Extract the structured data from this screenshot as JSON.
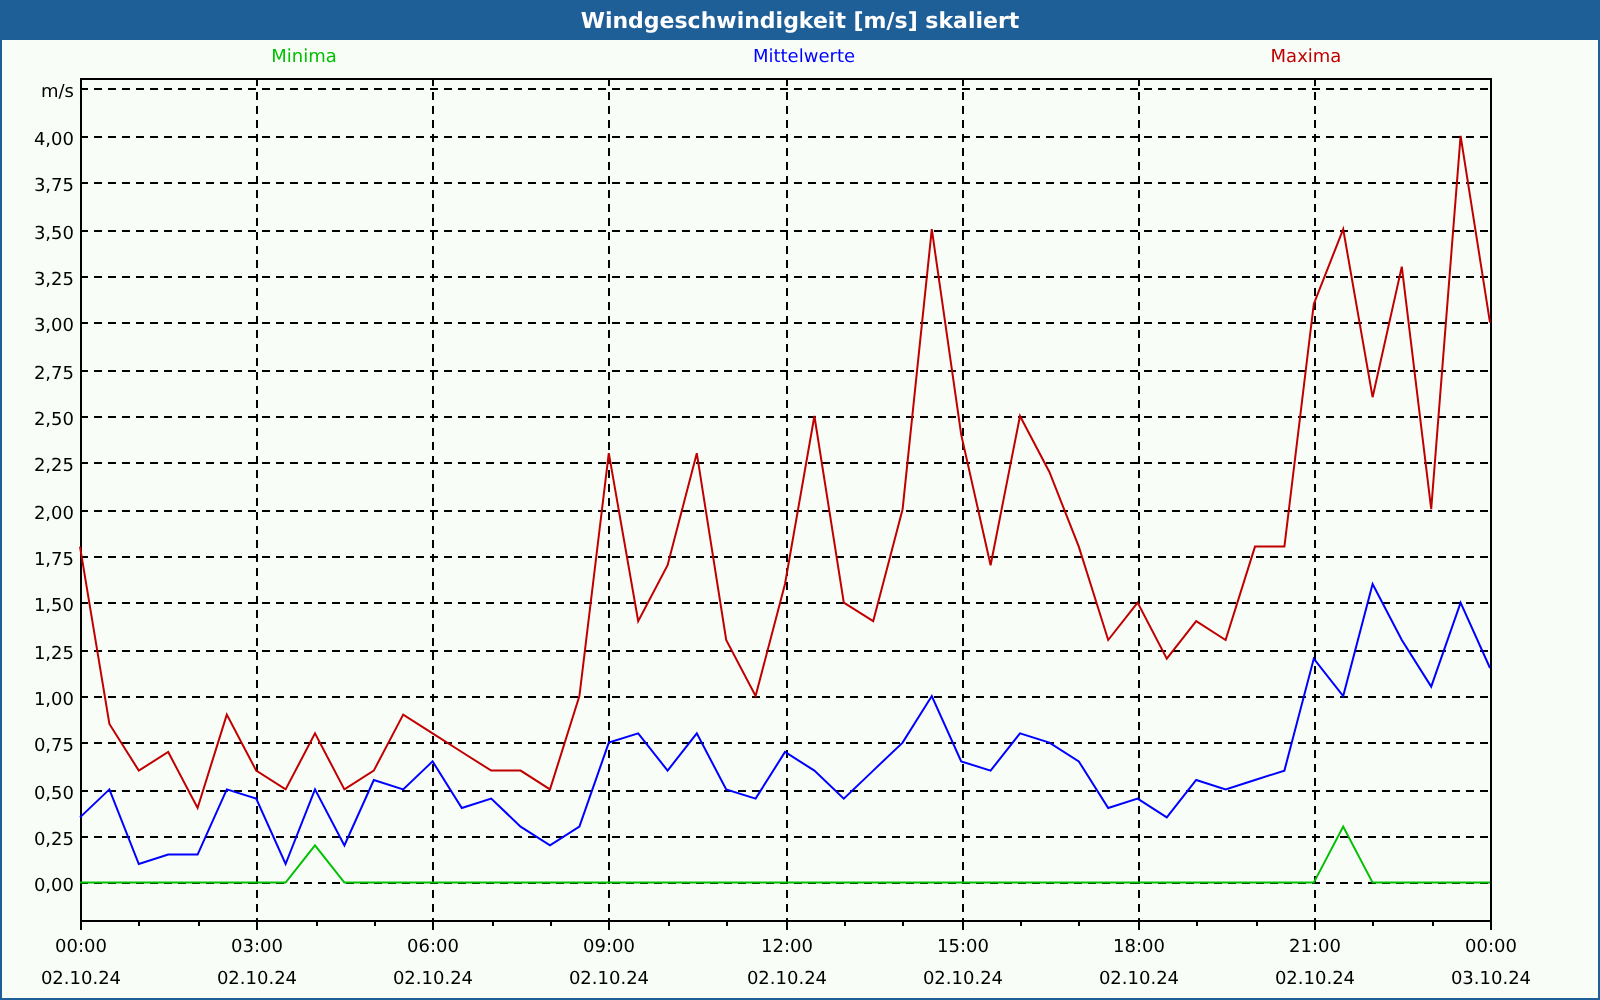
{
  "window": {
    "title": "Windgeschwindigkeit [m/s] skaliert"
  },
  "chart": {
    "chart_data": {
      "type": "line",
      "grid": true,
      "ylabel": "m/s",
      "ylim": [
        -0.2,
        4.31
      ],
      "categories": [
        "00:00\n02.10.24",
        null,
        null,
        null,
        null,
        null,
        "03:00\n02.10.24",
        null,
        null,
        null,
        null,
        null,
        "06:00\n02.10.24",
        null,
        null,
        null,
        null,
        null,
        "09:00\n02.10.24",
        null,
        null,
        null,
        null,
        null,
        "12:00\n02.10.24",
        null,
        null,
        null,
        null,
        null,
        "15:00\n02.10.24",
        null,
        null,
        null,
        null,
        null,
        "18:00\n02.10.24",
        null,
        null,
        null,
        null,
        null,
        "21:00\n02.10.24",
        null,
        null,
        null,
        null,
        null,
        "00:00\n03.10.24"
      ],
      "series": [
        {
          "name": "Minima",
          "color": "#00c000",
          "values": [
            0,
            0,
            0,
            0,
            0,
            0,
            0,
            0,
            0.2,
            0,
            0,
            0,
            0,
            0,
            0,
            0,
            0,
            0,
            0,
            0,
            0,
            0,
            0,
            0,
            0,
            0,
            0,
            0,
            0,
            0,
            0,
            0,
            0,
            0,
            0,
            0,
            0,
            0,
            0,
            0,
            0,
            0,
            0,
            0.3,
            0,
            0,
            0,
            0,
            0
          ]
        },
        {
          "name": "Mittelwerte",
          "color": "#0000ff",
          "values": [
            0.35,
            0.5,
            0.1,
            0.15,
            0.15,
            0.5,
            0.45,
            0.1,
            0.5,
            0.2,
            0.55,
            0.5,
            0.65,
            0.4,
            0.45,
            0.3,
            0.2,
            0.3,
            0.75,
            0.8,
            0.6,
            0.8,
            0.5,
            0.45,
            0.7,
            0.6,
            0.45,
            0.6,
            0.75,
            1.0,
            0.65,
            0.6,
            0.8,
            0.75,
            0.65,
            0.4,
            0.45,
            0.35,
            0.55,
            0.5,
            0.55,
            0.6,
            1.2,
            1.0,
            1.6,
            1.3,
            1.05,
            1.5,
            1.15
          ]
        },
        {
          "name": "Maxima",
          "color": "#c00000",
          "values": [
            1.8,
            0.85,
            0.6,
            0.7,
            0.4,
            0.9,
            0.6,
            0.5,
            0.8,
            0.5,
            0.6,
            0.9,
            0.8,
            0.7,
            0.6,
            0.6,
            0.5,
            1.0,
            2.3,
            1.4,
            1.7,
            2.3,
            1.3,
            1.0,
            1.6,
            2.5,
            1.5,
            1.4,
            2.0,
            3.5,
            2.4,
            1.7,
            2.5,
            2.2,
            1.8,
            1.3,
            1.5,
            1.2,
            1.4,
            1.3,
            1.8,
            1.8,
            3.1,
            3.5,
            2.6,
            3.3,
            2.0,
            4.0,
            3.0
          ]
        }
      ],
      "yticks": [
        {
          "value": 0,
          "label": "0,00"
        },
        {
          "value": 0.25,
          "label": "0,25"
        },
        {
          "value": 0.5,
          "label": "0,50"
        },
        {
          "value": 0.75,
          "label": "0,75"
        },
        {
          "value": 1,
          "label": "1,00"
        },
        {
          "value": 1.25,
          "label": "1,25"
        },
        {
          "value": 1.5,
          "label": "1,50"
        },
        {
          "value": 1.75,
          "label": "1,75"
        },
        {
          "value": 2,
          "label": "2,00"
        },
        {
          "value": 2.25,
          "label": "2,25"
        },
        {
          "value": 2.5,
          "label": "2,50"
        },
        {
          "value": 2.75,
          "label": "2,75"
        },
        {
          "value": 3,
          "label": "3,00"
        },
        {
          "value": 3.25,
          "label": "3,25"
        },
        {
          "value": 3.5,
          "label": "3,50"
        },
        {
          "value": 3.75,
          "label": "3,75"
        },
        {
          "value": 4,
          "label": "4,00"
        }
      ]
    }
  }
}
